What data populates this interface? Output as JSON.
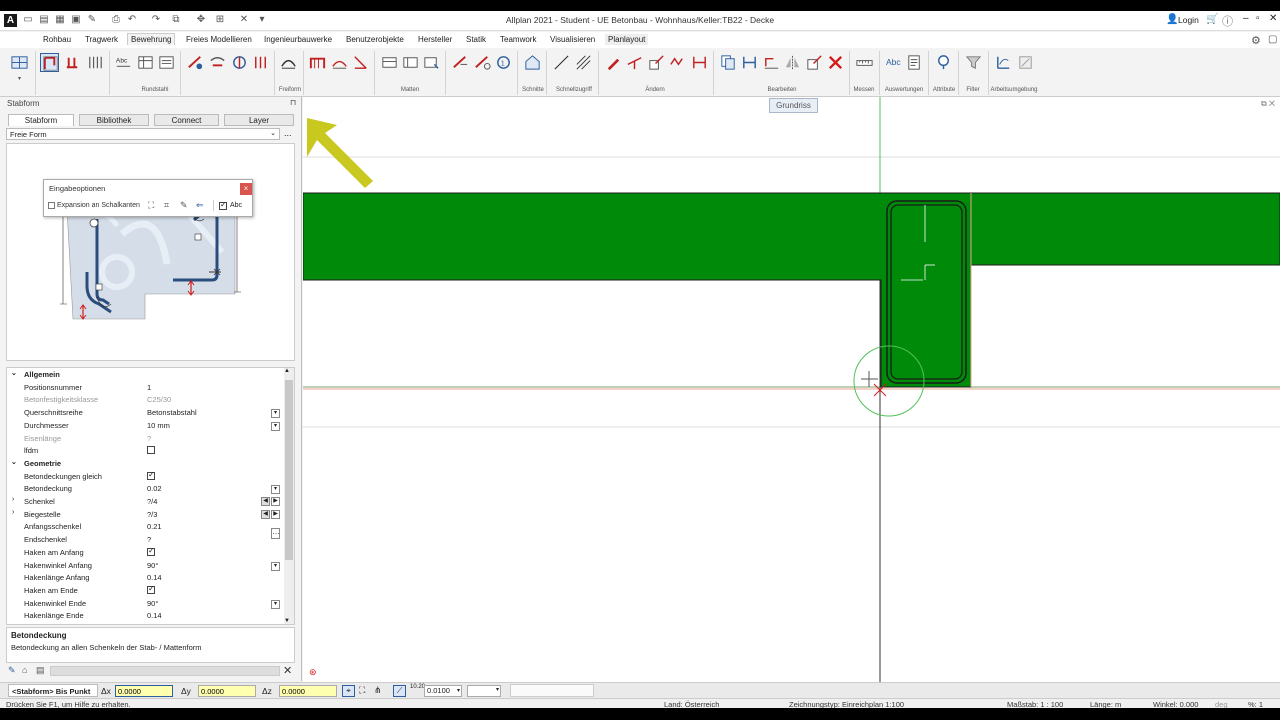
{
  "window": {
    "title": "Allplan 2021 - Student - UE Betonbau - Wohnhaus/Keller:TB22 - Decke",
    "login": "Login"
  },
  "menu": {
    "tabs": [
      "Rohbau",
      "Tragwerk",
      "Bewehrung",
      "Freies Modellieren",
      "Ingenieurbauwerke",
      "Benutzerobjekte",
      "Hersteller",
      "Statik",
      "Teamwork",
      "Visualisieren",
      "Planlayout"
    ],
    "active": "Bewehrung"
  },
  "ribbon": {
    "groups": [
      "Freiform",
      "Rundstahl",
      "Matten",
      "Schnitte",
      "Schnellzugriff",
      "Ändern",
      "Bearbeiten",
      "Messen",
      "Auswertungen",
      "Attribute",
      "Filter",
      "Arbeitsumgebung"
    ],
    "abc_label": "Abc"
  },
  "panel": {
    "title": "Stabform",
    "tabs": [
      "Stabform",
      "Bibliothek",
      "Connect",
      "Layer"
    ],
    "shape_select": "Freie Form",
    "more": "...",
    "popup": {
      "title": "Eingabeoptionen",
      "close": "×",
      "option": "Expansion an Schalkanten",
      "abc": "Abc"
    },
    "sections": {
      "allgemein": "Allgemein",
      "geometrie": "Geometrie"
    },
    "props": {
      "positionsnummer": {
        "k": "Positionsnummer",
        "v": "1"
      },
      "betonfestigkeit": {
        "k": "Betonfestigkeitsklasse",
        "v": "C25/30"
      },
      "querschnitt": {
        "k": "Querschnittsreihe",
        "v": "Betonstabstahl"
      },
      "durchmesser": {
        "k": "Durchmesser",
        "v": "10 mm"
      },
      "eisenlaenge": {
        "k": "Eisenlänge",
        "v": "?"
      },
      "lfdm": {
        "k": "lfdm",
        "v": ""
      },
      "betondeckungen_gleich": {
        "k": "Betondeckungen gleich",
        "v": ""
      },
      "betondeckung": {
        "k": "Betondeckung",
        "v": "0.02"
      },
      "schenkel": {
        "k": "Schenkel",
        "v": "?/4"
      },
      "biegestelle": {
        "k": "Biegestelle",
        "v": "?/3"
      },
      "anfangsschenkel": {
        "k": "Anfangsschenkel",
        "v": "0.21"
      },
      "endschenkel": {
        "k": "Endschenkel",
        "v": "?"
      },
      "haken_anfang": {
        "k": "Haken am Anfang",
        "v": ""
      },
      "hakenwinkel_anfang": {
        "k": "Hakenwinkel Anfang",
        "v": "90°"
      },
      "hakenlaenge_anfang": {
        "k": "Hakenlänge Anfang",
        "v": "0.14"
      },
      "haken_ende": {
        "k": "Haken am Ende",
        "v": ""
      },
      "hakenwinkel_ende": {
        "k": "Hakenwinkel Ende",
        "v": "90°"
      },
      "hakenlaenge_ende": {
        "k": "Hakenlänge Ende",
        "v": "0.14"
      }
    },
    "help": {
      "title": "Betondeckung",
      "text": "Betondeckung an allen Schenkeln der Stab- / Mattenform"
    }
  },
  "canvas": {
    "view_label": "Grundriss"
  },
  "inputbar": {
    "mode": "<Stabform> Bis Punkt",
    "dx_label": "Δx",
    "dx": "0.0000",
    "dy_label": "Δy",
    "dy": "0.0000",
    "dz_label": "Δz",
    "dz": "0.0000",
    "step": "0.0100"
  },
  "status": {
    "hint": "Drücken Sie F1, um Hilfe zu erhalten.",
    "land": "Land:  Österreich",
    "zeichnungstyp": "Zeichnungstyp:  Einreichplan 1:100",
    "massstab": "Maßstab:  1 : 100",
    "laenge": "Länge:  m",
    "winkel": "Winkel:  0.000",
    "deg": "deg",
    "percent": "%:  1"
  },
  "colors": {
    "green": "#008a0a",
    "accent_red": "#d21a1a",
    "cursor": "#33c040"
  }
}
